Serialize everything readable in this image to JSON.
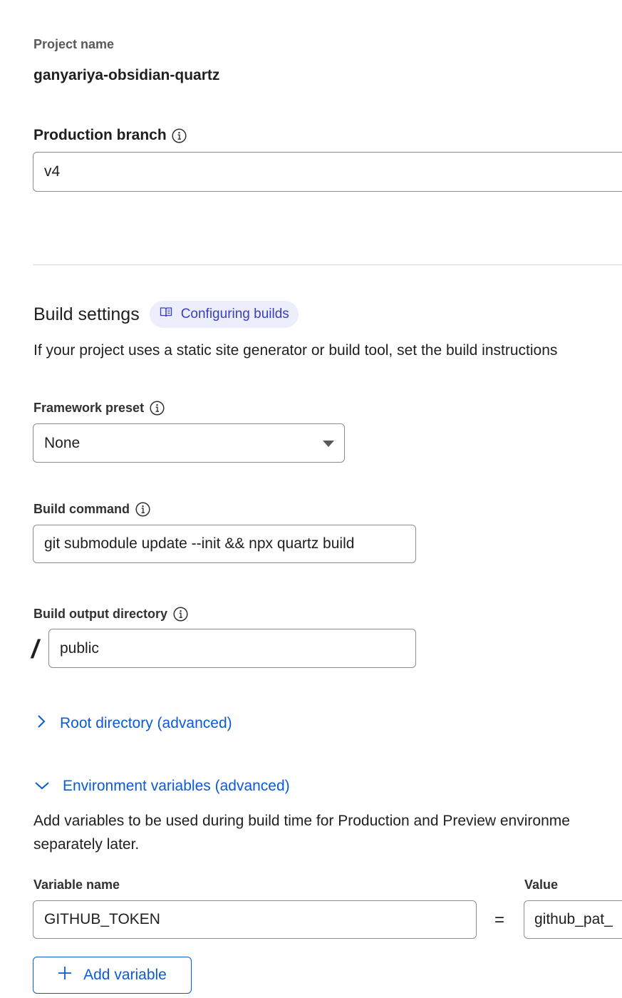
{
  "project": {
    "label": "Project name",
    "value": "ganyariya-obsidian-quartz"
  },
  "production_branch": {
    "label": "Production branch",
    "value": "v4",
    "info_icon": "info-icon"
  },
  "build_settings": {
    "title": "Build settings",
    "doc_link_label": "Configuring builds",
    "doc_icon": "book-icon",
    "description": "If your project uses a static site generator or build tool, set the build instructions"
  },
  "framework_preset": {
    "label": "Framework preset",
    "selected": "None",
    "info_icon": "info-icon"
  },
  "build_command": {
    "label": "Build command",
    "value": "git submodule update --init && npx quartz build",
    "info_icon": "info-icon"
  },
  "build_output": {
    "label": "Build output directory",
    "prefix": "/",
    "value": "public",
    "info_icon": "info-icon"
  },
  "root_directory": {
    "label": "Root directory (advanced)",
    "icon": "chevron-right-icon"
  },
  "env_vars": {
    "label": "Environment variables (advanced)",
    "icon": "chevron-down-icon",
    "description_line1": "Add variables to be used during build time for Production and Preview environme",
    "description_line2": "separately later.",
    "name_header": "Variable name",
    "value_header": "Value",
    "rows": [
      {
        "name": "GITHUB_TOKEN",
        "equals": "=",
        "value": "github_pat_"
      }
    ],
    "add_button_label": "Add variable",
    "add_icon": "plus-icon"
  },
  "colors": {
    "link": "#0b5bd3",
    "pill_bg": "#eceefc",
    "pill_text": "#3a3ec0",
    "border": "#8c8c8c"
  }
}
